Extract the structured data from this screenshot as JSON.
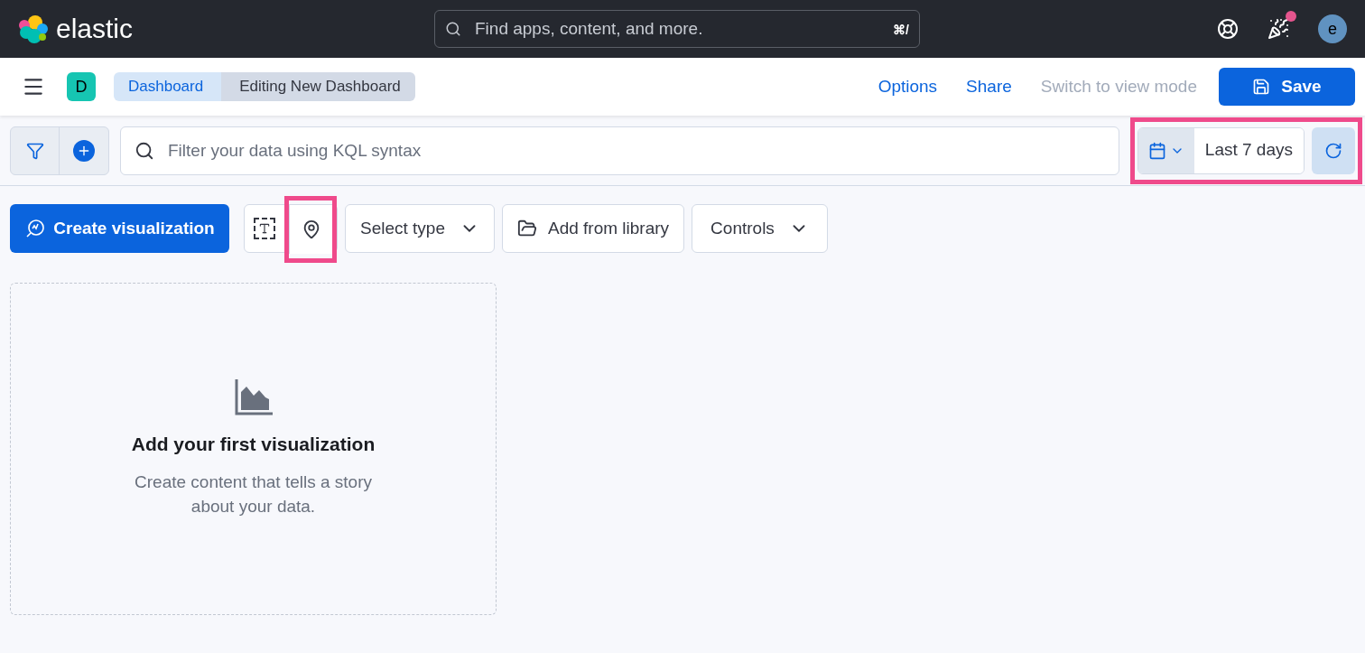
{
  "header": {
    "logo_text": "elastic",
    "search": {
      "placeholder": "Find apps, content, and more.",
      "shortcut": "⌘/"
    },
    "notification_unread": true,
    "avatar_initial": "e"
  },
  "nav": {
    "space_initial": "D",
    "breadcrumbs": [
      {
        "label": "Dashboard",
        "selected": false
      },
      {
        "label": "Editing New Dashboard",
        "selected": true
      }
    ],
    "actions": [
      {
        "label": "Options",
        "disabled": false
      },
      {
        "label": "Share",
        "disabled": false
      },
      {
        "label": "Switch to view mode",
        "disabled": true
      }
    ],
    "save_button": "Save"
  },
  "query_bar": {
    "placeholder": "Filter your data using KQL syntax",
    "time_range": "Last 7 days",
    "time_picker_highlighted": true
  },
  "toolbar": {
    "create_button": "Create visualization",
    "map_button_highlighted": true,
    "select_type": "Select type",
    "add_from_library": "Add from library",
    "controls": "Controls"
  },
  "empty_panel": {
    "title": "Add your first visualization",
    "description": "Create content that tells a story about your data."
  }
}
